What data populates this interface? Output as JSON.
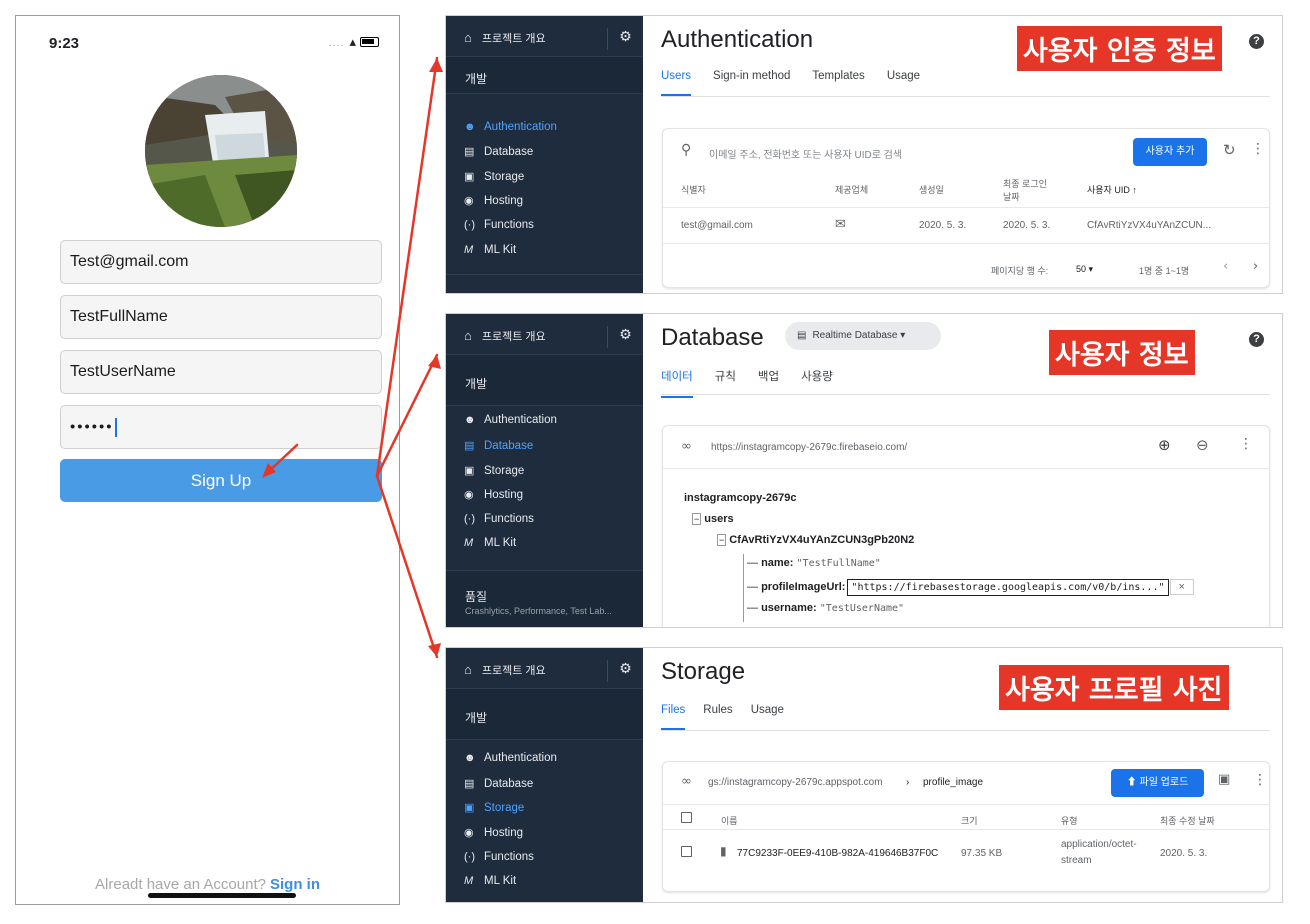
{
  "phone": {
    "time": "9:23",
    "signal": "....",
    "wifi": "▾",
    "email": "Test@gmail.com",
    "fullname": "TestFullName",
    "username": "TestUserName",
    "password": "••••••",
    "signup": "Sign Up",
    "already": "Alreadt have an Account?",
    "signin": "Sign in"
  },
  "sidebar": {
    "home": "프로젝트 개요",
    "dev": "개발",
    "items": [
      "Authentication",
      "Database",
      "Storage",
      "Hosting",
      "Functions",
      "ML Kit"
    ],
    "quality": "품질",
    "quality_sub": "Crashlytics, Performance, Test Lab..."
  },
  "auth": {
    "title": "Authentication",
    "tabs": [
      "Users",
      "Sign-in method",
      "Templates",
      "Usage"
    ],
    "search": "이메일 주소, 전화번호 또는 사용자 UID로 검색",
    "add": "사용자 추가",
    "cols": [
      "식별자",
      "제공업체",
      "생성일",
      "최종 로그인 날짜",
      "사용자 UID ↑"
    ],
    "row": [
      "test@gmail.com",
      "2020. 5. 3.",
      "2020. 5. 3.",
      "CfAvRtiYzVX4uYAnZCUN..."
    ],
    "footer": "페이지당 행 수:",
    "per": "50",
    "range": "1명 중 1~1명",
    "label": "사용자 인증 정보"
  },
  "db": {
    "title": "Database",
    "chip": "Realtime Database",
    "tabs": [
      "데이터",
      "규칙",
      "백업",
      "사용량"
    ],
    "url": "https://instagramcopy-2679c.firebaseio.com/",
    "root": "instagramcopy-2679c",
    "users": "users",
    "uid": "CfAvRtiYzVX4uYAnZCUN3gPb20N2",
    "name_k": "name:",
    "name_v": "\"TestFullName\"",
    "url_k": "profileImageUrl:",
    "url_v": "\"https://firebasestorage.googleapis.com/v0/b/ins...\"",
    "user_k": "username:",
    "user_v": "\"TestUserName\"",
    "label": "사용자 정보"
  },
  "storage": {
    "title": "Storage",
    "tabs": [
      "Files",
      "Rules",
      "Usage"
    ],
    "path": "gs://instagramcopy-2679c.appspot.com",
    "folder": "profile_image",
    "upload": "파일 업로드",
    "cols": [
      "이름",
      "크기",
      "유형",
      "최종 수정 날짜"
    ],
    "file": "77C9233F-0EE9-410B-982A-419646B37F0C",
    "size": "97.35 KB",
    "type1": "application/octet-",
    "type2": "stream",
    "date": "2020. 5. 3.",
    "label": "사용자 프로필 사진"
  },
  "colors": {
    "accent": "#1a73e8",
    "sidebar": "#1f2c3d",
    "label_red": "#e53627",
    "phone_button": "#4a9be6"
  }
}
